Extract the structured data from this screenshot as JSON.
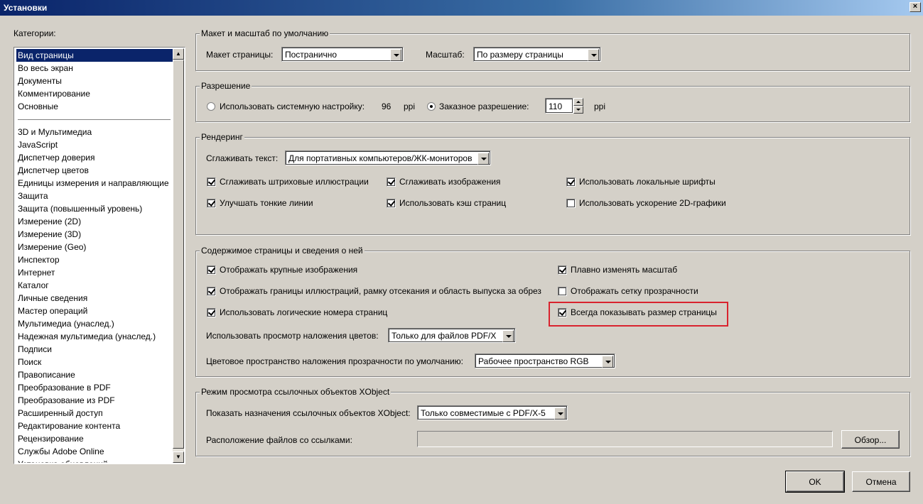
{
  "window": {
    "title": "Установки",
    "close_glyph": "×"
  },
  "categories": {
    "label": "Категории:",
    "items_top": [
      "Вид страницы",
      "Во весь экран",
      "Документы",
      "Комментирование",
      "Основные"
    ],
    "items": [
      "3D и Мультимедиа",
      "JavaScript",
      "Диспетчер доверия",
      "Диспетчер цветов",
      "Единицы измерения и направляющие",
      "Защита",
      "Защита (повышенный уровень)",
      "Измерение (2D)",
      "Измерение (3D)",
      "Измерение (Geo)",
      "Инспектор",
      "Интернет",
      "Каталог",
      "Личные сведения",
      "Мастер операций",
      "Мультимедиа (унаслед.)",
      "Надежная мультимедиа (унаслед.)",
      "Подписи",
      "Поиск",
      "Правописание",
      "Преобразование в PDF",
      "Преобразование из PDF",
      "Расширенный доступ",
      "Редактирование контента",
      "Рецензирование",
      "Службы Adobe Online",
      "Установка обновлений"
    ],
    "selected": "Вид страницы"
  },
  "layout_group": {
    "title": "Макет и масштаб по умолчанию",
    "page_layout_label": "Макет страницы:",
    "page_layout_value": "Постранично",
    "zoom_label": "Масштаб:",
    "zoom_value": "По размеру страницы"
  },
  "resolution_group": {
    "title": "Разрешение",
    "system_label": "Использовать системную настройку:",
    "system_value": "96",
    "system_unit": "ppi",
    "custom_label": "Заказное разрешение:",
    "custom_value": "110",
    "custom_unit": "ppi",
    "selected": "custom"
  },
  "rendering_group": {
    "title": "Рендеринг",
    "smooth_text_label": "Сглаживать текст:",
    "smooth_text_value": "Для портативных компьютеров/ЖК-мониторов",
    "options": [
      {
        "label": "Сглаживать штриховые иллюстрации",
        "checked": true
      },
      {
        "label": "Сглаживать изображения",
        "checked": true
      },
      {
        "label": "Использовать локальные шрифты",
        "checked": true
      },
      {
        "label": "Улучшать тонкие линии",
        "checked": true
      },
      {
        "label": "Использовать кэш страниц",
        "checked": true
      },
      {
        "label": "Использовать ускорение 2D-графики",
        "checked": false
      }
    ]
  },
  "content_group": {
    "title": "Содержимое страницы и сведения о ней",
    "options": [
      {
        "label": "Отображать крупные изображения",
        "checked": true
      },
      {
        "label": "Плавно изменять масштаб",
        "checked": true
      },
      {
        "label": "Отображать границы иллюстраций, рамку отсекания и область выпуска за обрез",
        "checked": true
      },
      {
        "label": "Отображать сетку прозрачности",
        "checked": false
      },
      {
        "label": "Использовать логические номера страниц",
        "checked": true
      },
      {
        "label": "Всегда показывать размер страницы",
        "checked": true
      }
    ],
    "overprint_label": "Использовать просмотр наложения цветов:",
    "overprint_value": "Только для файлов PDF/X",
    "blend_label": "Цветовое пространство наложения прозрачности по умолчанию:",
    "blend_value": "Рабочее пространство RGB"
  },
  "xobject_group": {
    "title": "Режим просмотра ссылочных объектов XObject",
    "show_label": "Показать назначения ссылочных объектов XObject:",
    "show_value": "Только совместимые с PDF/X-5",
    "location_label": "Расположение файлов со ссылками:",
    "location_value": "",
    "browse_label": "Обзор..."
  },
  "footer": {
    "ok_label": "OK",
    "cancel_label": "Отмена"
  },
  "colors": {
    "highlight": "#d9232e",
    "selection": "#0a246a",
    "face": "#d4d0c8"
  }
}
